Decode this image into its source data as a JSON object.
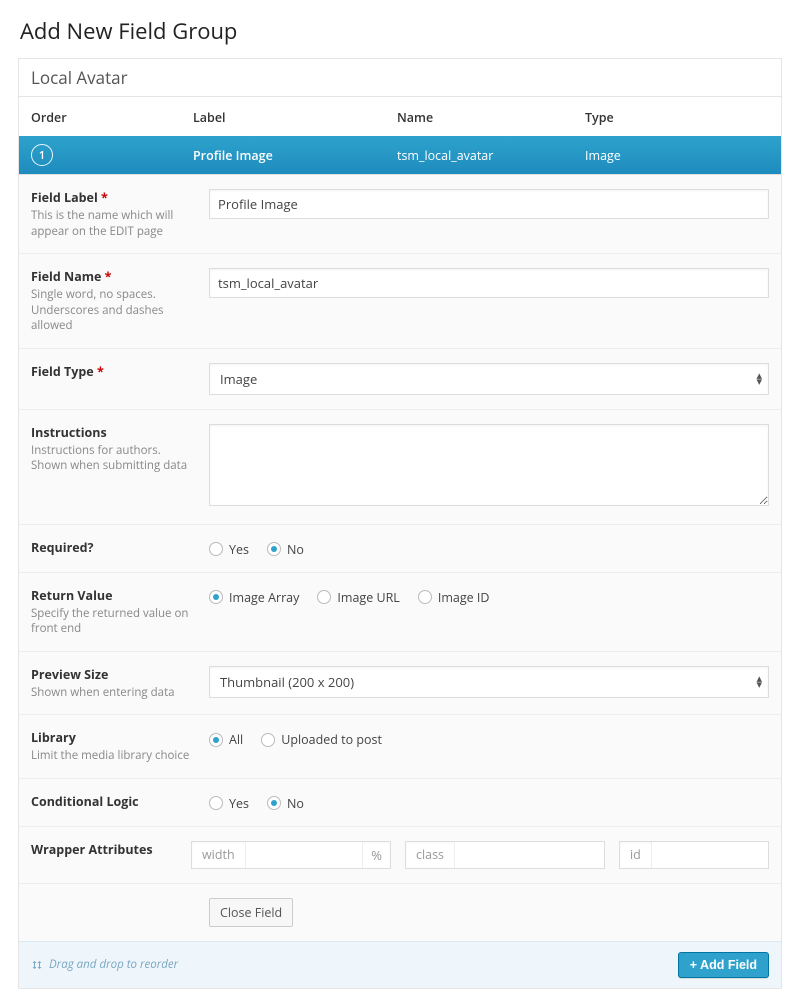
{
  "page": {
    "title": "Add New Field Group"
  },
  "group": {
    "title": "Local Avatar"
  },
  "columns": {
    "order": "Order",
    "label": "Label",
    "name": "Name",
    "type": "Type"
  },
  "row": {
    "order": "1",
    "label": "Profile Image",
    "name": "tsm_local_avatar",
    "type": "Image"
  },
  "fields": {
    "field_label": {
      "label": "Field Label",
      "help": "This is the name which will appear on the EDIT page",
      "value": "Profile Image"
    },
    "field_name": {
      "label": "Field Name",
      "help": "Single word, no spaces. Underscores and dashes allowed",
      "value": "tsm_local_avatar"
    },
    "field_type": {
      "label": "Field Type",
      "value": "Image"
    },
    "instructions": {
      "label": "Instructions",
      "help": "Instructions for authors. Shown when submitting data",
      "value": ""
    },
    "required": {
      "label": "Required?",
      "options": {
        "yes": "Yes",
        "no": "No"
      },
      "selected": "no"
    },
    "return_value": {
      "label": "Return Value",
      "help": "Specify the returned value on front end",
      "options": {
        "array": "Image Array",
        "url": "Image URL",
        "id": "Image ID"
      },
      "selected": "array"
    },
    "preview_size": {
      "label": "Preview Size",
      "help": "Shown when entering data",
      "value": "Thumbnail (200 x 200)"
    },
    "library": {
      "label": "Library",
      "help": "Limit the media library choice",
      "options": {
        "all": "All",
        "uploaded": "Uploaded to post"
      },
      "selected": "all"
    },
    "conditional": {
      "label": "Conditional Logic",
      "options": {
        "yes": "Yes",
        "no": "No"
      },
      "selected": "no"
    },
    "wrapper": {
      "label": "Wrapper Attributes",
      "width_label": "width",
      "width_unit": "%",
      "class_label": "class",
      "id_label": "id"
    },
    "close": {
      "label": "Close Field"
    }
  },
  "footer": {
    "reorder_hint": "Drag and drop to reorder",
    "add_field": "+ Add Field"
  }
}
